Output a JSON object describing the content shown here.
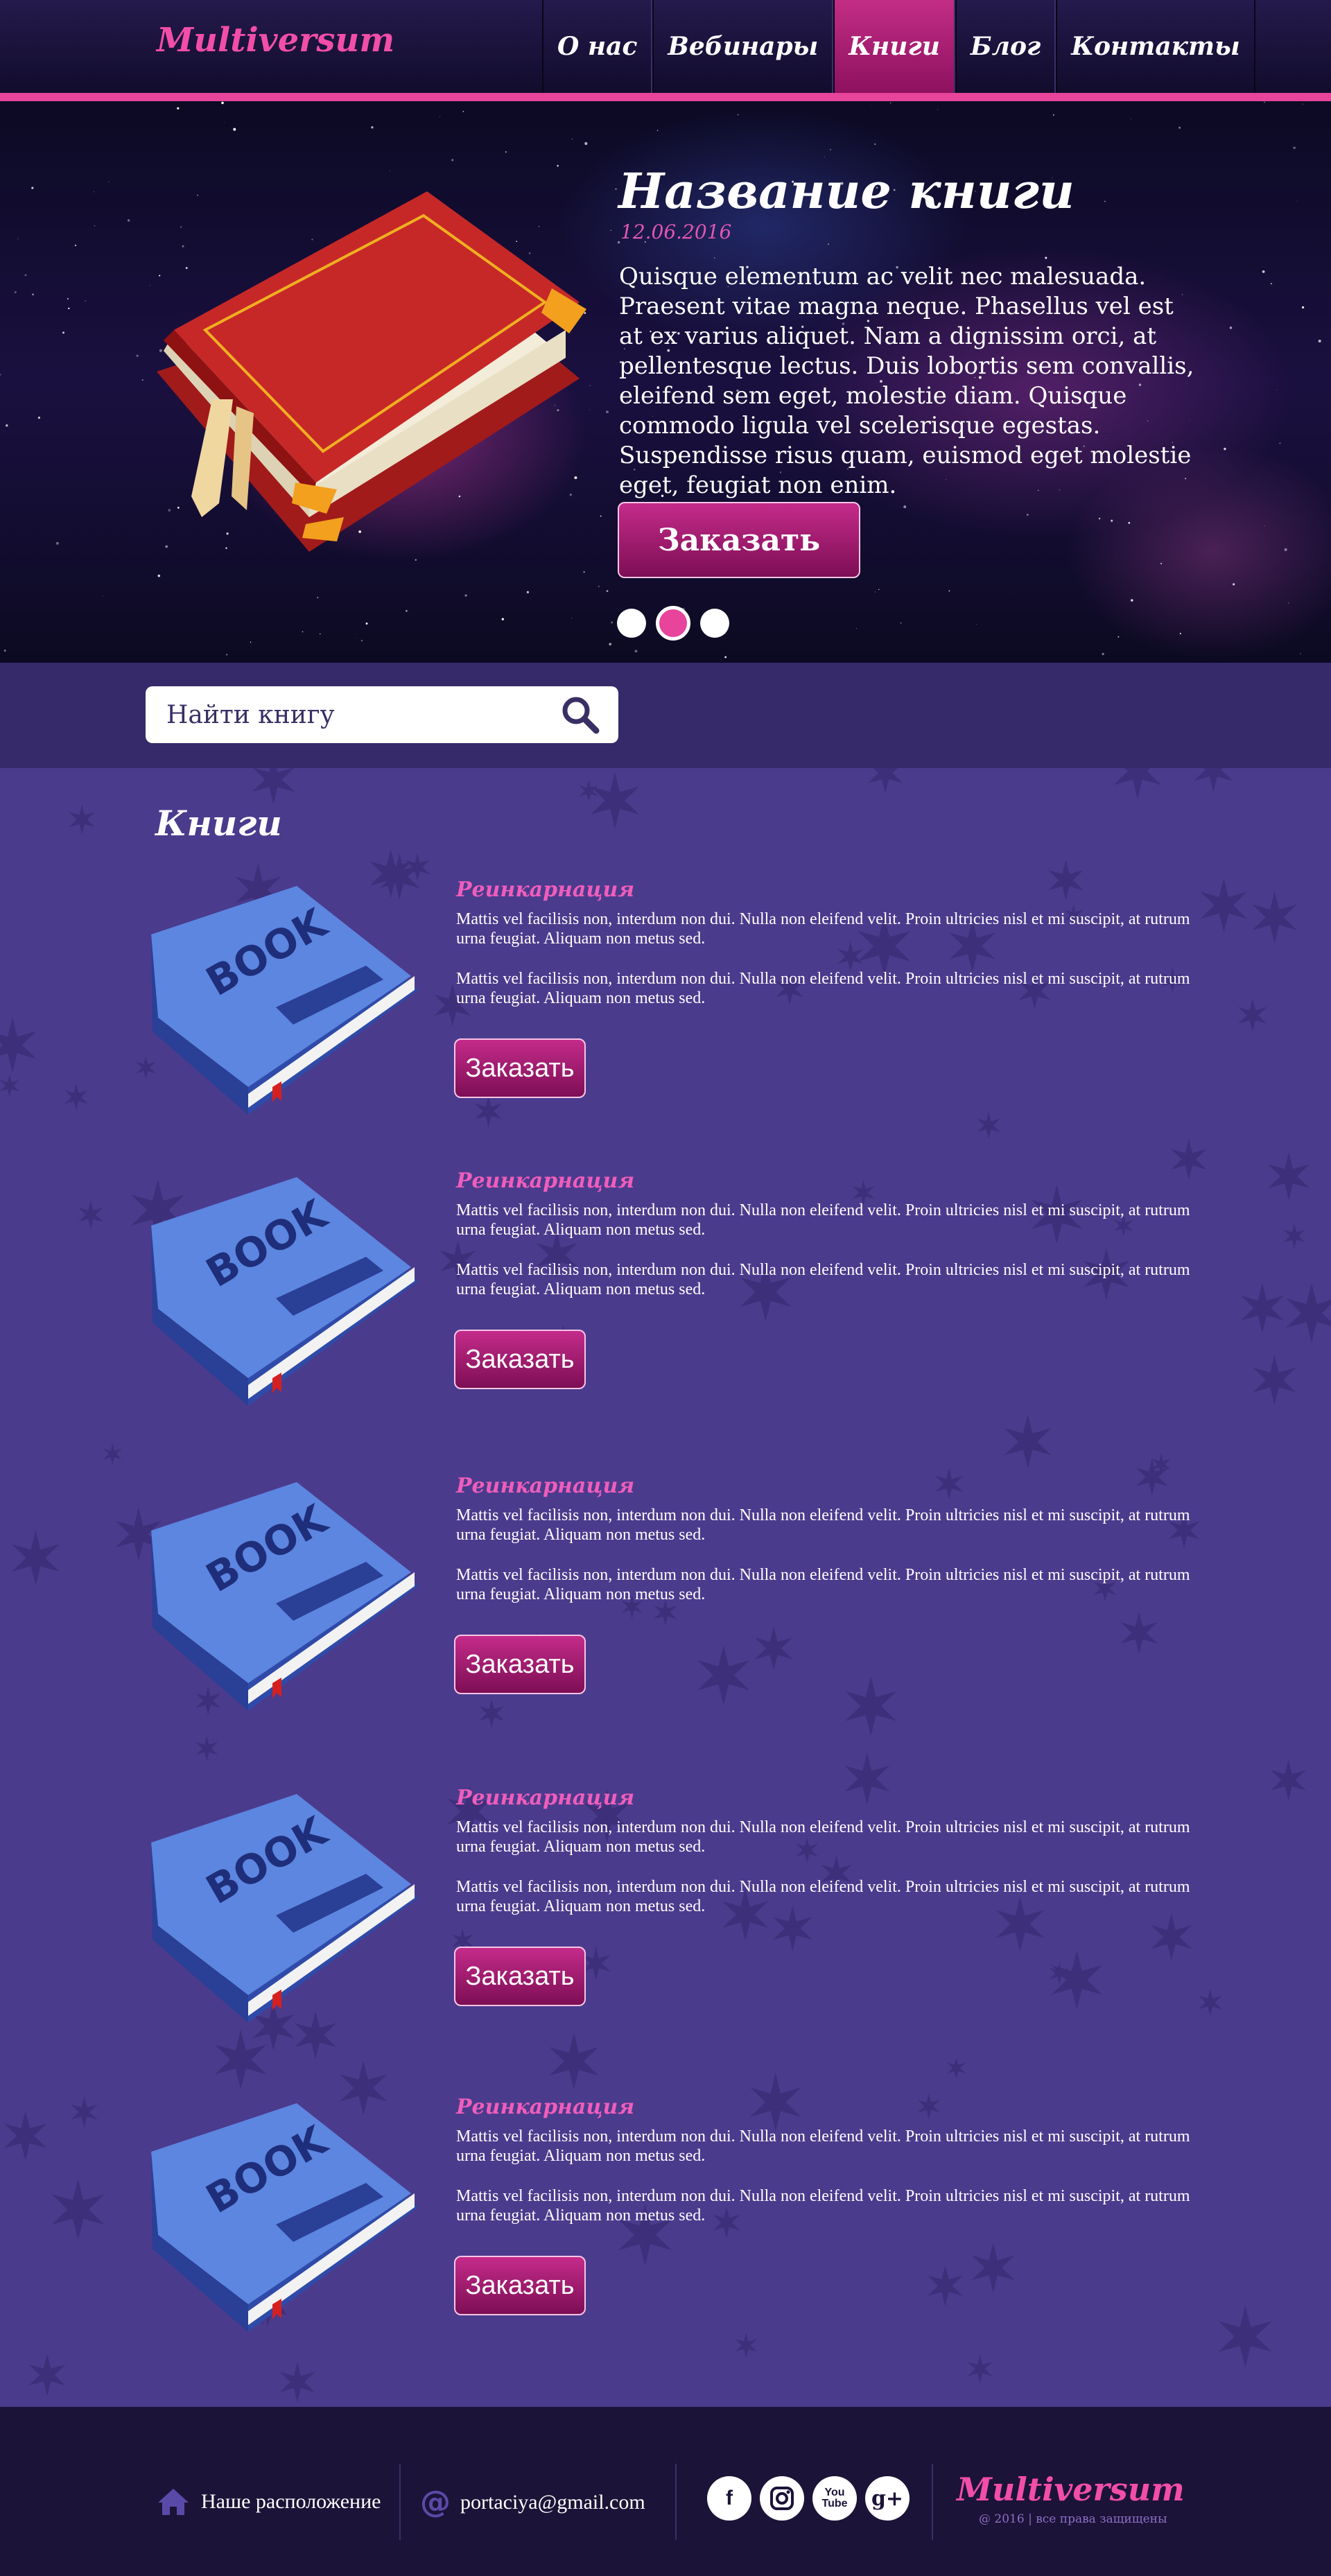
{
  "header": {
    "logo": "Multiversum",
    "nav": [
      {
        "label": "О нас",
        "active": false
      },
      {
        "label": "Вебинары",
        "active": false
      },
      {
        "label": "Книги",
        "active": true
      },
      {
        "label": "Блог",
        "active": false
      },
      {
        "label": "Контакты",
        "active": false
      }
    ]
  },
  "hero": {
    "title": "Название книги",
    "date": "12.06.2016",
    "text": "Quisque elementum ac velit nec malesuada. Praesent vitae magna neque. Phasellus vel est at ex varius aliquet. Nam a dignissim orci, at pellentesque lectus. Duis lobortis sem convallis, eleifend sem eget, molestie diam. Quisque commodo ligula vel scelerisque egestas. Suspendisse risus quam, euismod eget molestie eget, feugiat non enim.",
    "button": "Заказать",
    "slides": 3,
    "active_slide": 2
  },
  "search": {
    "placeholder": "Найти книгу"
  },
  "books": {
    "section_title": "Книги",
    "book_cover_label": "BOOK",
    "items": [
      {
        "title": "Реинкарнация",
        "p1": "Mattis vel facilisis non, interdum non dui. Nulla non eleifend velit. Proin ultricies nisl et mi suscipit, at rutrum urna feugiat. Aliquam non metus sed.",
        "p2": "Mattis vel facilisis non, interdum non dui. Nulla non eleifend velit. Proin ultricies nisl et mi suscipit, at rutrum urna feugiat. Aliquam non metus sed.",
        "button": "Заказать"
      },
      {
        "title": "Реинкарнация",
        "p1": "Mattis vel facilisis non, interdum non dui. Nulla non eleifend velit. Proin ultricies nisl et mi suscipit, at rutrum urna feugiat. Aliquam non metus sed.",
        "p2": "Mattis vel facilisis non, interdum non dui. Nulla non eleifend velit. Proin ultricies nisl et mi suscipit, at rutrum urna feugiat. Aliquam non metus sed.",
        "button": "Заказать"
      },
      {
        "title": "Реинкарнация",
        "p1": "Mattis vel facilisis non, interdum non dui. Nulla non eleifend velit. Proin ultricies nisl et mi suscipit, at rutrum urna feugiat. Aliquam non metus sed.",
        "p2": "Mattis vel facilisis non, interdum non dui. Nulla non eleifend velit. Proin ultricies nisl et mi suscipit, at rutrum urna feugiat. Aliquam non metus sed.",
        "button": "Заказать"
      },
      {
        "title": "Реинкарнация",
        "p1": "Mattis vel facilisis non, interdum non dui. Nulla non eleifend velit. Proin ultricies nisl et mi suscipit, at rutrum urna feugiat. Aliquam non metus sed.",
        "p2": "Mattis vel facilisis non, interdum non dui. Nulla non eleifend velit. Proin ultricies nisl et mi suscipit, at rutrum urna feugiat. Aliquam non metus sed.",
        "button": "Заказать"
      },
      {
        "title": "Реинкарнация",
        "p1": "Mattis vel facilisis non, interdum non dui. Nulla non eleifend velit. Proin ultricies nisl et mi suscipit, at rutrum urna feugiat. Aliquam non metus sed.",
        "p2": "Mattis vel facilisis non, interdum non dui. Nulla non eleifend velit. Proin ultricies nisl et mi suscipit, at rutrum urna feugiat. Aliquam non metus sed.",
        "button": "Заказать"
      }
    ]
  },
  "footer": {
    "location": "Наше расположение",
    "email": "portaciya@gmail.com",
    "social": [
      "facebook-icon",
      "instagram-icon",
      "youtube-icon",
      "google-plus-icon"
    ],
    "logo": "Multiversum",
    "copyright": "@ 2016 | все права защищены"
  },
  "colors": {
    "accent": "#e8449c",
    "header_bg": "#1a1238",
    "section_bg": "#4b3b8d",
    "footer_bg": "#1c1338"
  }
}
